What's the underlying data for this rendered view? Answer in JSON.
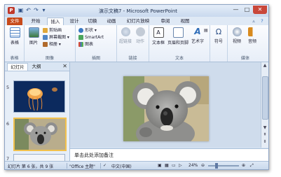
{
  "window": {
    "title": "演示文稿7 - Microsoft PowerPoint",
    "app_icon": "P",
    "controls": [
      "—",
      "□",
      "✕"
    ]
  },
  "quick_access": [
    "save-icon",
    "undo-icon",
    "redo-icon",
    "customize-icon"
  ],
  "tabs": [
    "文件",
    "开始",
    "插入",
    "设计",
    "切换",
    "动画",
    "幻灯片放映",
    "审阅",
    "视图"
  ],
  "active_tab": "插入",
  "ribbon": {
    "groups": {
      "tables": {
        "label": "表格",
        "btn": "表格"
      },
      "images": {
        "label": "图像",
        "picture": "图片",
        "clipart": "剪贴画",
        "screenshot": "屏幕截图",
        "album": "相册"
      },
      "illustrations": {
        "label": "插图",
        "shapes": "形状",
        "smartart": "SmartArt",
        "chart": "图表"
      },
      "links": {
        "label": "链接",
        "hyperlink": "超链接",
        "action": "动作"
      },
      "text": {
        "label": "文本",
        "textbox": "文本框",
        "headerfooter": "页眉和页脚",
        "wordart": "艺术字"
      },
      "symbols": {
        "label": "",
        "symbol": "符号"
      },
      "media": {
        "label": "媒体",
        "video": "视频",
        "audio": "音频"
      }
    }
  },
  "left_pane": {
    "tabs": [
      "幻灯片",
      "大纲"
    ],
    "close": "✕",
    "slides": [
      {
        "num": "5",
        "subject": "jellyfish"
      },
      {
        "num": "6",
        "subject": "koala",
        "selected": true
      },
      {
        "num": "7",
        "subject": ""
      }
    ]
  },
  "notes": {
    "placeholder": "单击此处添加备注"
  },
  "status": {
    "slide_info": "幻灯片 第 6 张，共 9 张",
    "theme": "\"Office 主题\"",
    "language": "中文(中国)",
    "zoom": "24%",
    "zoom_level": 0.24
  },
  "colors": {
    "file_tab": "#c74a1a",
    "thumb_selected_border": "#f2c14c",
    "ribbon_bg": "#fbfcfe"
  }
}
